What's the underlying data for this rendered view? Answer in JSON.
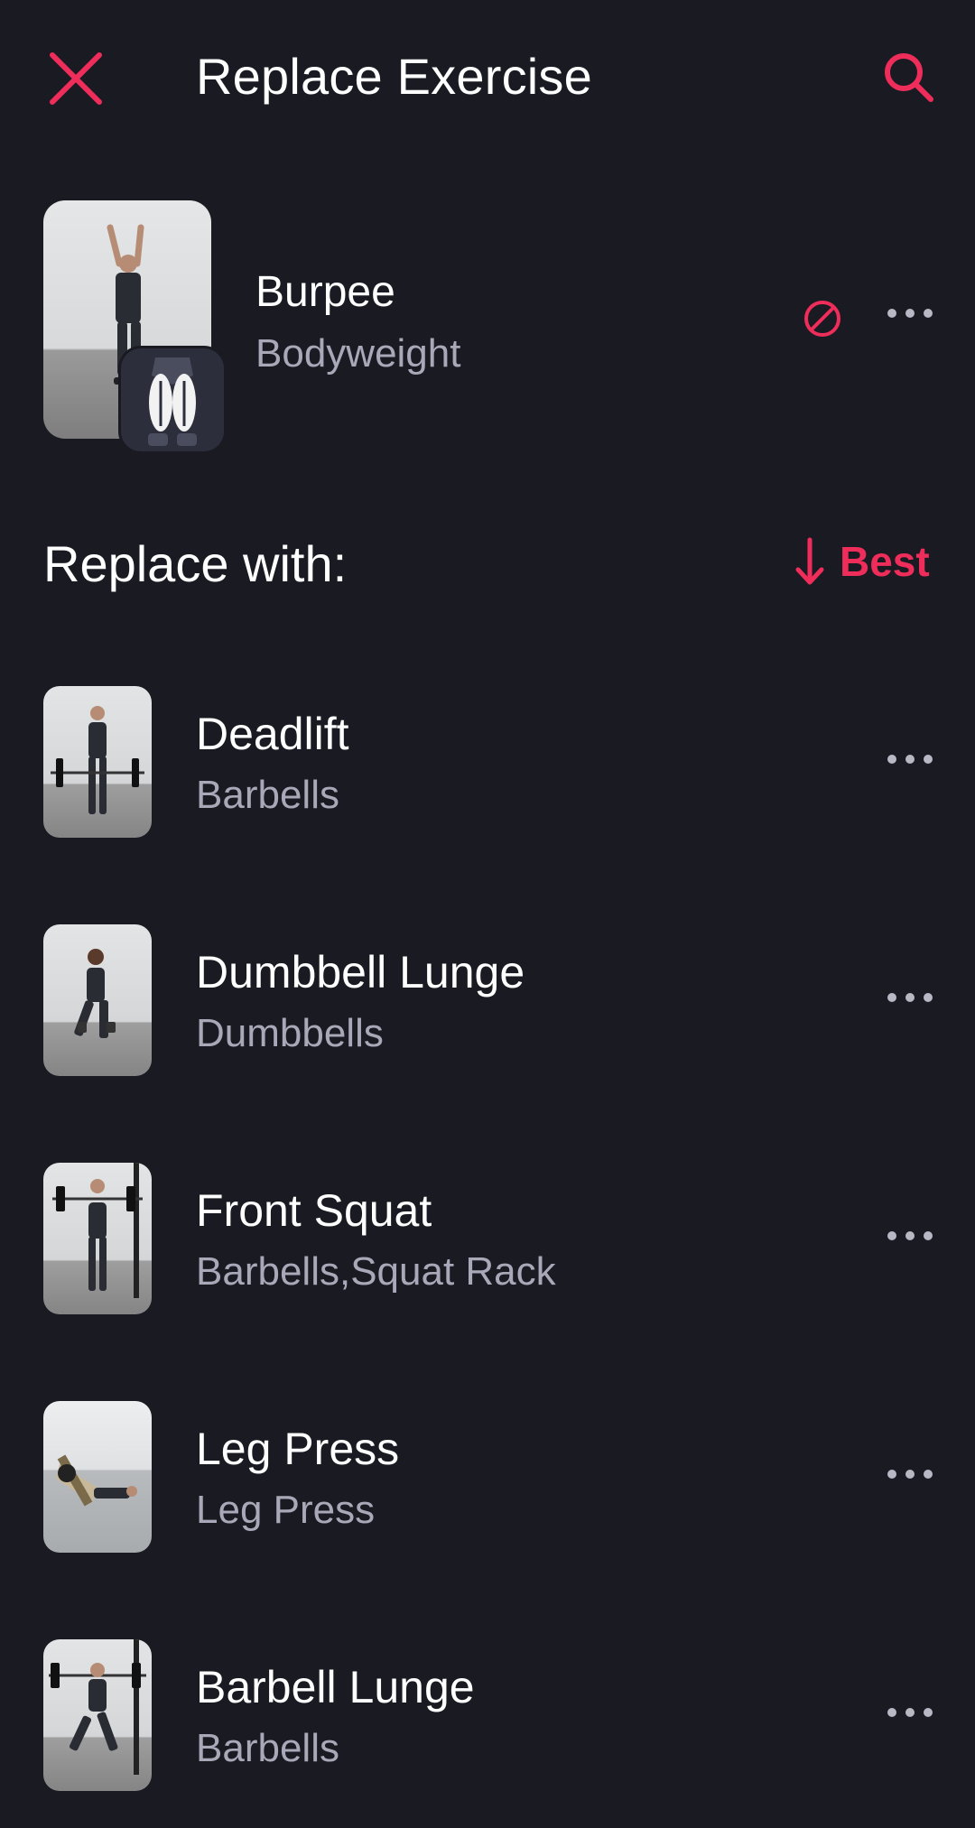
{
  "header": {
    "title": "Replace Exercise",
    "close_icon": "close-icon",
    "search_icon": "search-icon"
  },
  "current_exercise": {
    "name": "Burpee",
    "equipment": "Bodyweight",
    "block_icon": "block-icon",
    "more_icon": "more-horizontal-icon"
  },
  "replace_section": {
    "heading": "Replace with:",
    "sort_label": "Best",
    "sort_icon": "arrow-down-icon"
  },
  "exercises": [
    {
      "name": "Deadlift",
      "equipment": "Barbells"
    },
    {
      "name": "Dumbbell Lunge",
      "equipment": "Dumbbells"
    },
    {
      "name": "Front Squat",
      "equipment": "Barbells,Squat Rack"
    },
    {
      "name": "Leg Press",
      "equipment": "Leg Press"
    },
    {
      "name": "Barbell Lunge",
      "equipment": "Barbells"
    }
  ],
  "colors": {
    "background": "#1a1a22",
    "accent": "#ee2d5b",
    "secondary_text": "#a8a8b8",
    "primary_text": "#ffffff"
  }
}
